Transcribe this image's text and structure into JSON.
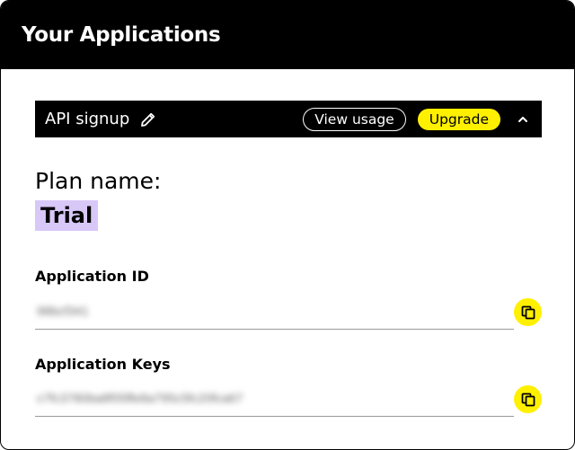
{
  "header": {
    "title": "Your Applications"
  },
  "application": {
    "name": "API signup",
    "view_usage_label": "View usage",
    "upgrade_label": "Upgrade"
  },
  "plan": {
    "label": "Plan name:",
    "value": "Trial"
  },
  "fields": {
    "app_id": {
      "label": "Application ID",
      "value": "98bcf341"
    },
    "app_keys": {
      "label": "Application Keys",
      "value": "c7fc3780ba8f05ffe8a795c5fc20fca67"
    }
  },
  "colors": {
    "accent_yellow": "#fff000",
    "plan_highlight": "#d8c8f8",
    "bar": "#000000"
  },
  "icons": [
    "pencil-icon",
    "chevron-up-icon",
    "copy-icon"
  ]
}
